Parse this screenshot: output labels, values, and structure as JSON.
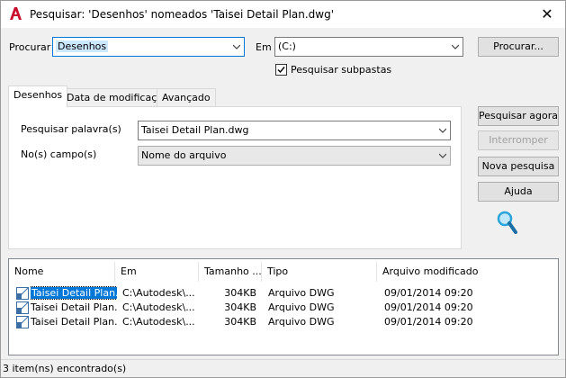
{
  "window": {
    "title": "Pesquisar: 'Desenhos' nomeados 'Taisei Detail Plan.dwg'",
    "app_icon": "autocad-a-icon",
    "close_label": "✕"
  },
  "top": {
    "procurar_label": "Procurar",
    "procurar_value": "Desenhos",
    "em_label": "Em",
    "em_value": "(C:)",
    "browse_label": "Procurar...",
    "subfolders_label": "Pesquisar subpastas",
    "subfolders_checked": true
  },
  "tabs": [
    "Desenhos",
    "Data de modificação",
    "Avançado"
  ],
  "panel": {
    "word_label": "Pesquisar palavra(s)",
    "word_value": "Taisei Detail Plan.dwg",
    "field_label": "No(s) campo(s)",
    "field_value": "Nome do arquivo"
  },
  "actions": {
    "search_now": "Pesquisar agora",
    "stop": "Interromper",
    "new_search": "Nova pesquisa",
    "help": "Ajuda"
  },
  "results": {
    "columns": [
      "Nome",
      "Em",
      "Tamanho ...",
      "Tipo",
      "Arquivo modificado"
    ],
    "rows": [
      {
        "name": "Taisei Detail Plan...",
        "in": "C:\\Autodesk\\...",
        "size": "304KB",
        "type": "Arquivo DWG",
        "modified": "09/01/2014 09:20"
      },
      {
        "name": "Taisei Detail Plan...",
        "in": "C:\\Autodesk\\...",
        "size": "304KB",
        "type": "Arquivo DWG",
        "modified": "09/01/2014 09:20"
      },
      {
        "name": "Taisei Detail Plan...",
        "in": "C:\\Autodesk\\...",
        "size": "304KB",
        "type": "Arquivo DWG",
        "modified": "09/01/2014 09:20"
      }
    ]
  },
  "status": "3 item(ns) encontrado(s)",
  "colors": {
    "accent": "#0078d7",
    "autocad_red": "#c8102e",
    "magnifier": "#2aa3d8"
  }
}
